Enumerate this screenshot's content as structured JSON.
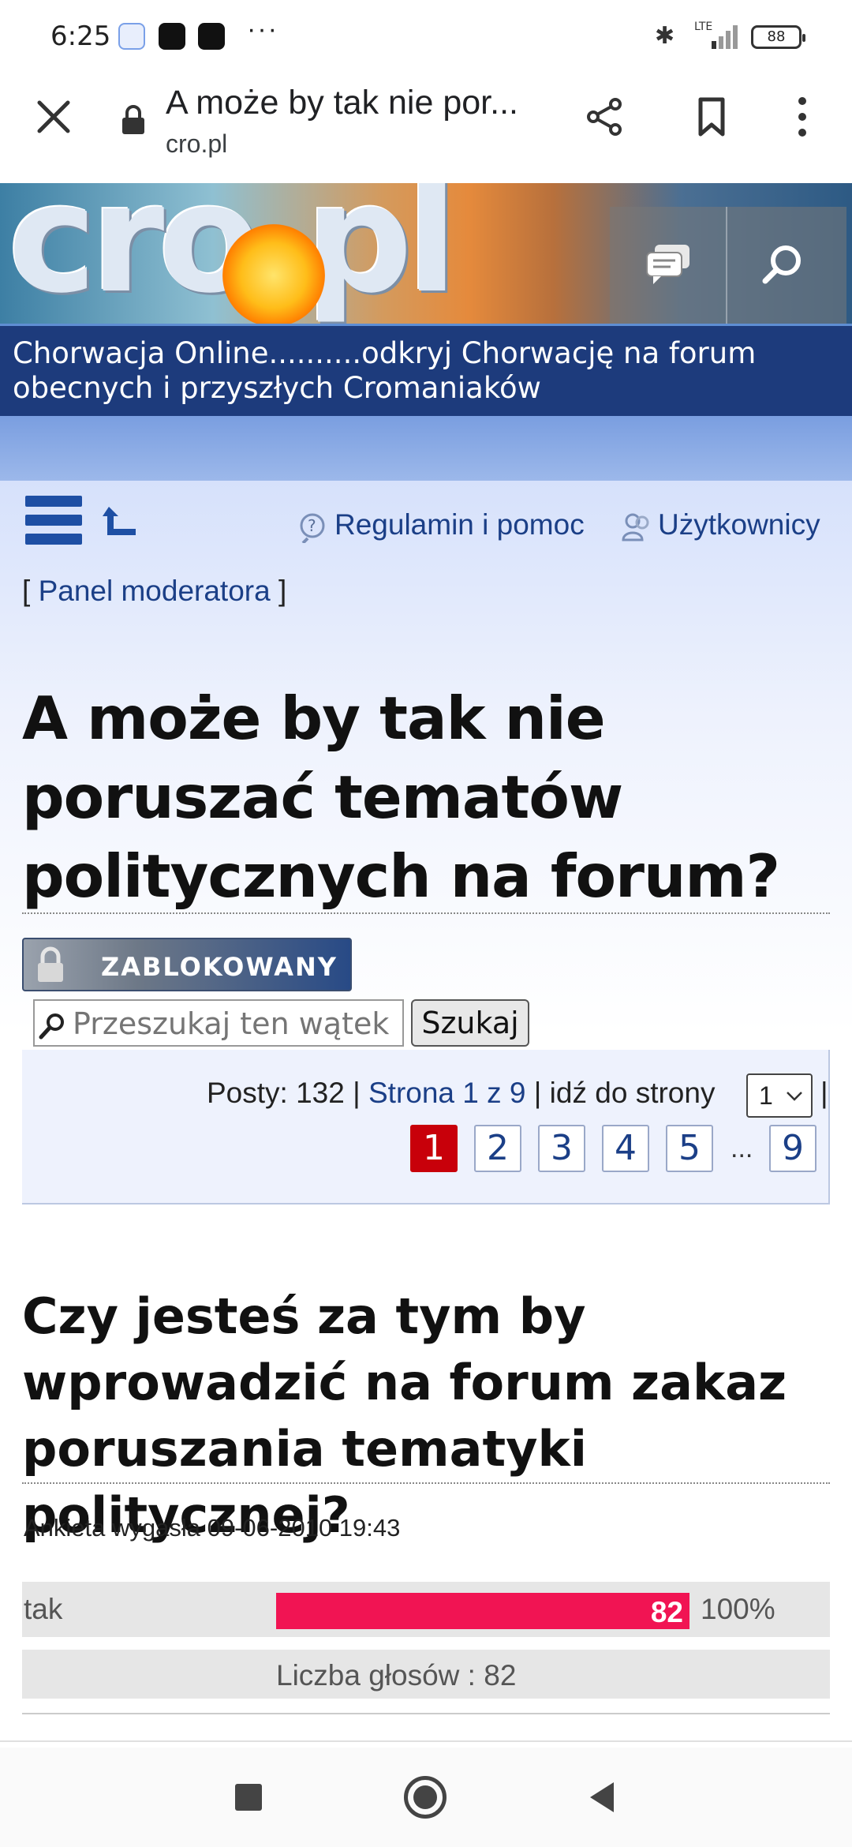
{
  "status_bar": {
    "time": "6:25",
    "network": "LTE",
    "battery": "88"
  },
  "browser": {
    "page_title": "A może by tak nie por...",
    "url": "cro.pl"
  },
  "banner": {
    "logo_text": "cro.pl",
    "tagline": "Chorwacja Online..........odkryj Chorwację na forum obecnych i przyszłych Cromaniaków"
  },
  "forum_nav": {
    "rules_link": "Regulamin i pomoc",
    "users_link": "Użytkownicy",
    "panel_prefix": "[ ",
    "panel_link": "Panel moderatora",
    "panel_suffix": " ]"
  },
  "thread": {
    "title": "A może by tak nie poruszać tematów politycznych na forum?",
    "locked_label": "ZABLOKOWANY"
  },
  "search": {
    "placeholder": "Przeszukaj ten wątek",
    "button": "Szukaj"
  },
  "pagination": {
    "posts_text": "Posty: 132 | ",
    "page_link": "Strona 1 z 9",
    "goto_text": " | idź do strony ",
    "selected_page": "1",
    "trailing_bar": "|",
    "pages": [
      "1",
      "2",
      "3",
      "4",
      "5",
      "9"
    ],
    "ellipsis": "..."
  },
  "poll": {
    "question": "Czy jesteś za tym by wprowadzić na forum zakaz poruszania tematyki politycznej?",
    "expired": "Ankieta wygasła 09-06-2010 19:43",
    "options": [
      {
        "label": "tak",
        "votes": "82",
        "percent": "100%",
        "fraction": 1.0
      }
    ],
    "total": "Liczba głosów : 82"
  },
  "colors": {
    "link": "#1b3f87",
    "active_page": "#c8000a",
    "vote_bar": "#f11453",
    "tagline_bar": "#1d3b7c"
  }
}
